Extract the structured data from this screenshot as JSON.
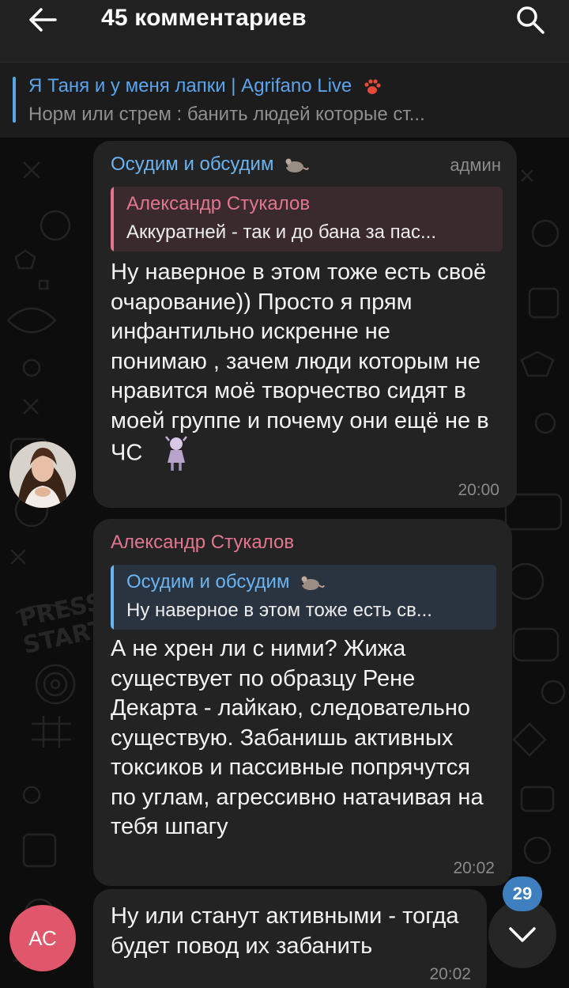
{
  "header": {
    "title": "45 комментариев",
    "back_icon": "arrow-left-icon",
    "search_icon": "search-icon"
  },
  "pinned": {
    "title": "Я Таня и у меня лапки | Agrifano Live",
    "text": "Норм или стрем : банить людей которые ст..."
  },
  "messages": [
    {
      "sender": "Осудим и обсудим",
      "badge": "админ",
      "reply_name": "Александр Стукалов",
      "reply_text": "Аккуратней - так и до бана за пас...",
      "text": "Ну наверное в этом тоже есть своё очарование)) Просто я прям инфантильно искренне не понимаю , зачем люди которым не нравится моё творчество сидят в моей группе и почему они ещё не в ЧС",
      "time": "20:00"
    },
    {
      "sender": "Александр Стукалов",
      "reply_name": "Осудим и обсудим",
      "reply_text": "Ну наверное в этом тоже есть св...",
      "text": "А не хрен ли с ними? Жижа существует по образцу Рене Декарта - лайкаю, следовательно существую. Забанишь активных токсиков и пассивные попрячутся по углам, агрессивно натачивая на тебя шпагу",
      "time": "20:02"
    },
    {
      "text": "Ну или станут активными - тогда будет повод их забанить",
      "time": "20:02",
      "avatar_initials": "АС"
    }
  ],
  "unread_count": "29",
  "colors": {
    "accent_blue": "#6ab4f2",
    "accent_pink": "#e2768f",
    "bubble": "#232323",
    "header": "#212121"
  }
}
